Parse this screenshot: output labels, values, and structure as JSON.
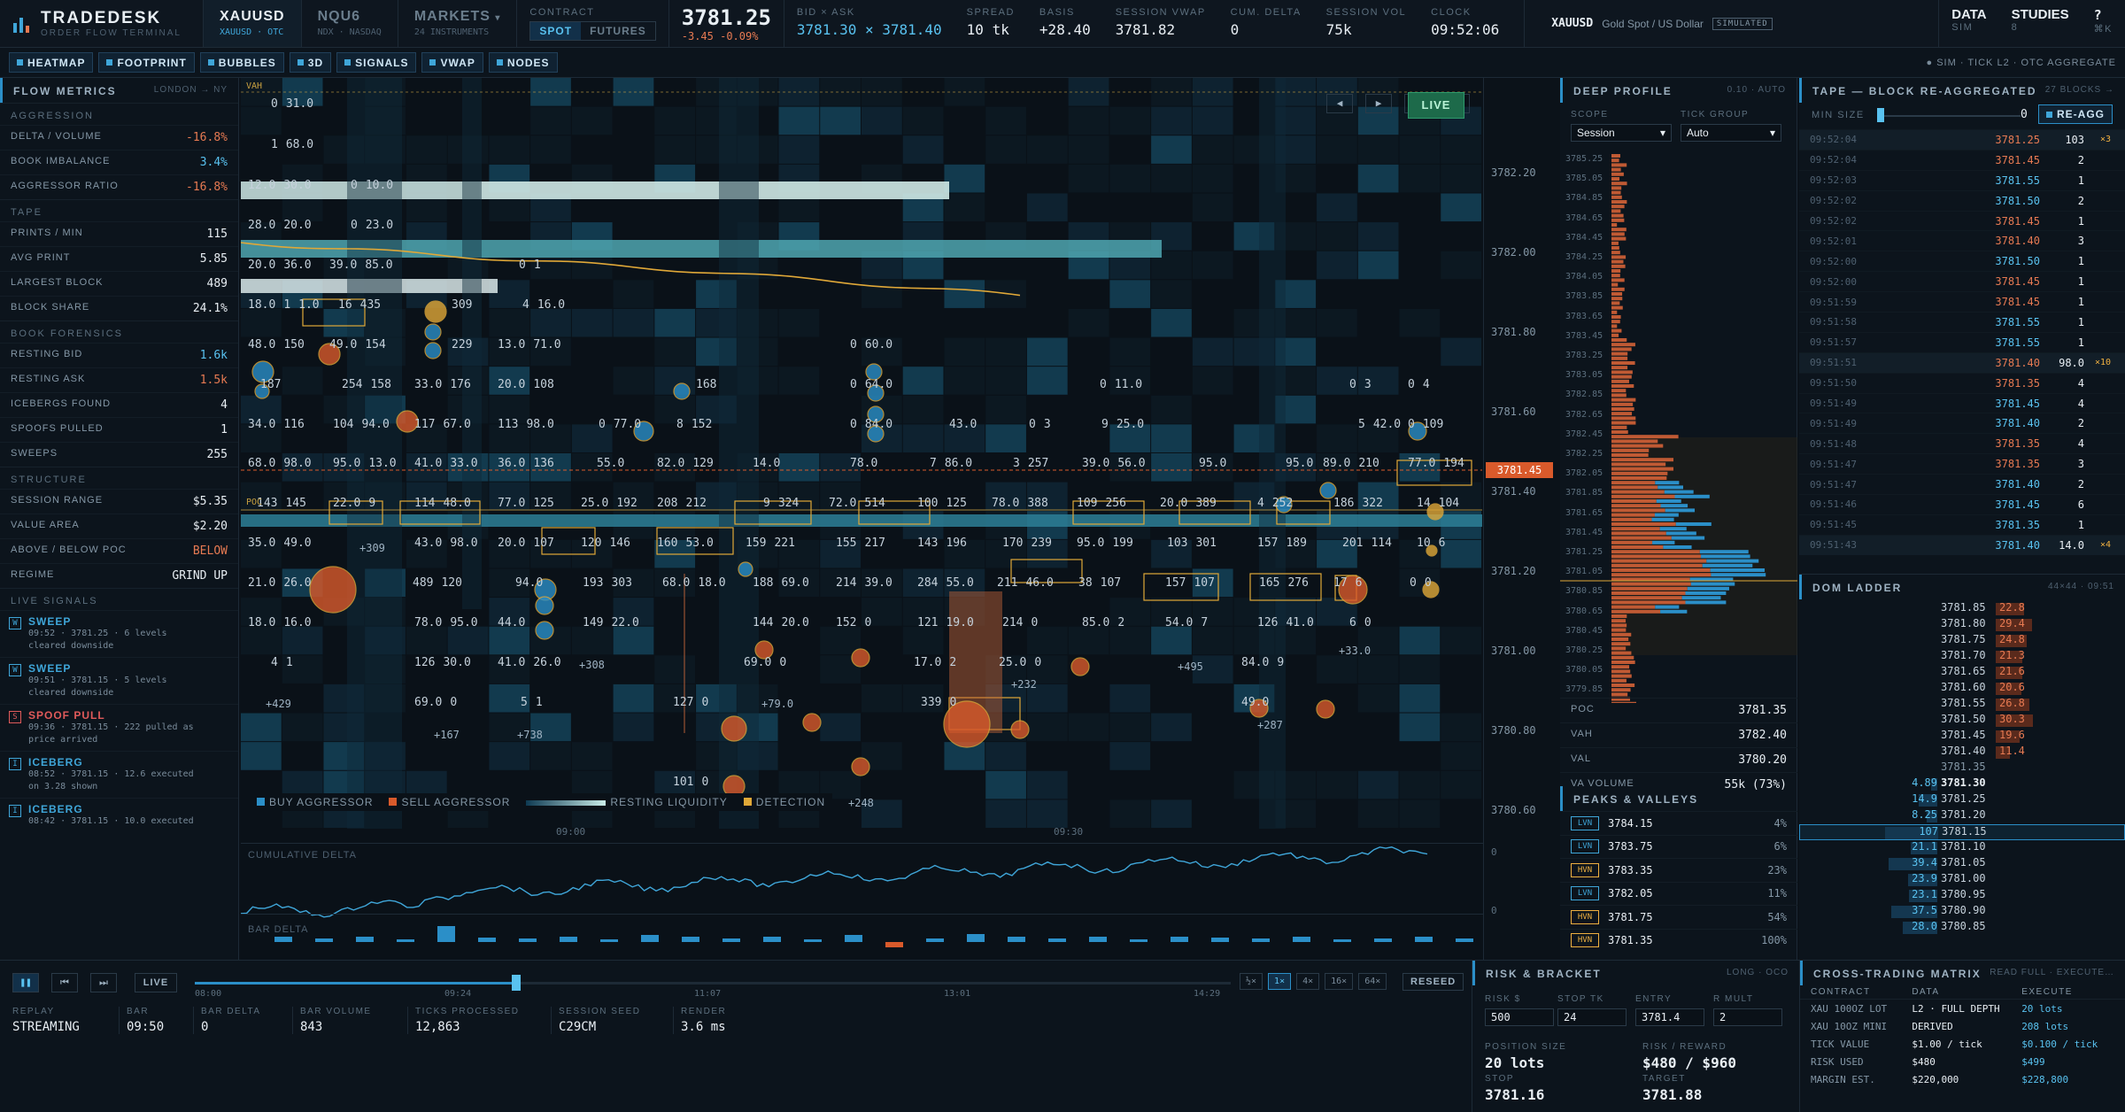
{
  "header": {
    "brand": "TRADEDESK",
    "brand_sub": "ORDER FLOW TERMINAL",
    "symbols": [
      {
        "name": "XAUUSD",
        "desc": "XAUUSD · OTC",
        "active": true
      },
      {
        "name": "NQU6",
        "desc": "NDX · NASDAQ",
        "active": false
      },
      {
        "name": "MARKETS",
        "desc": "24 INSTRUMENTS",
        "active": false
      }
    ],
    "contract_label": "CONTRACT",
    "spot": "SPOT",
    "futures": "FUTURES",
    "last": "3781.25",
    "change": "-3.45 -0.09%",
    "stats": [
      {
        "l": "BID × ASK",
        "v": "3781.30 × 3781.40"
      },
      {
        "l": "SPREAD",
        "v": "10 tk"
      },
      {
        "l": "BASIS",
        "v": "+28.40"
      },
      {
        "l": "SESSION VWAP",
        "v": "3781.82"
      },
      {
        "l": "CUM. DELTA",
        "v": "0"
      },
      {
        "l": "SESSION VOL",
        "v": "75k"
      },
      {
        "l": "CLOCK",
        "v": "09:52:06"
      }
    ],
    "instrument": "XAUUSD",
    "instrument_desc": "Gold Spot / US Dollar",
    "simulated": "SIMULATED",
    "data": "DATA",
    "data_sub": "SIM",
    "studies": "STUDIES",
    "studies_sub": "8",
    "help": "?",
    "help_sub": "⌘K"
  },
  "toolbar": {
    "buttons": [
      "HEATMAP",
      "FOOTPRINT",
      "BUBBLES",
      "3D",
      "SIGNALS",
      "VWAP",
      "NODES"
    ],
    "status": "● SIM · TICK L2 · OTC AGGREGATE"
  },
  "flow": {
    "title": "FLOW METRICS",
    "session": "LONDON → NY",
    "aggression_h": "AGGRESSION",
    "aggression": [
      {
        "k": "DELTA / VOLUME",
        "v": "-16.8%",
        "c": "neg"
      },
      {
        "k": "BOOK IMBALANCE",
        "v": "3.4%",
        "c": "pos"
      },
      {
        "k": "AGGRESSOR RATIO",
        "v": "-16.8%",
        "c": "neg"
      }
    ],
    "tape_h": "TAPE",
    "tape": [
      {
        "k": "PRINTS / MIN",
        "v": "115"
      },
      {
        "k": "AVG PRINT",
        "v": "5.85"
      },
      {
        "k": "LARGEST BLOCK",
        "v": "489"
      },
      {
        "k": "BLOCK SHARE",
        "v": "24.1%"
      }
    ],
    "forensics_h": "BOOK FORENSICS",
    "forensics": [
      {
        "k": "RESTING BID",
        "v": "1.6k",
        "c": "pos"
      },
      {
        "k": "RESTING ASK",
        "v": "1.5k",
        "c": "neg"
      },
      {
        "k": "ICEBERGS FOUND",
        "v": "4"
      },
      {
        "k": "SPOOFS PULLED",
        "v": "1"
      },
      {
        "k": "SWEEPS",
        "v": "255"
      }
    ],
    "structure_h": "STRUCTURE",
    "structure": [
      {
        "k": "SESSION RANGE",
        "v": "$5.35"
      },
      {
        "k": "VALUE AREA",
        "v": "$2.20"
      },
      {
        "k": "ABOVE / BELOW POC",
        "v": "BELOW",
        "c": "neg"
      },
      {
        "k": "REGIME",
        "v": "GRIND UP"
      }
    ],
    "signals_h": "LIVE SIGNALS",
    "signals": [
      {
        "b": "W",
        "t": "SWEEP",
        "d": "09:52 · 3781.25 · 6 levels cleared downside"
      },
      {
        "b": "W",
        "t": "SWEEP",
        "d": "09:51 · 3781.15 · 5 levels cleared downside"
      },
      {
        "b": "S",
        "t": "SPOOF PULL",
        "d": "09:36 · 3781.15 · 222 pulled as price arrived"
      },
      {
        "b": "I",
        "t": "ICEBERG",
        "d": "08:52 · 3781.15 · 12.6 executed on 3.28 shown"
      },
      {
        "b": "I",
        "t": "ICEBERG",
        "d": "08:42 · 3781.15 · 10.0 executed"
      }
    ]
  },
  "chart": {
    "vah": "VAH",
    "poc": "POC",
    "live": "LIVE",
    "prices": [
      "3782.20",
      "3782.00",
      "3781.80",
      "3781.60",
      "3781.40",
      "3781.20",
      "3781.00",
      "3780.80",
      "3780.60"
    ],
    "last_tag": "3781.45",
    "times": [
      "09:00",
      "09:30"
    ],
    "legend": [
      "BUY AGGRESSOR",
      "SELL AGGRESSOR",
      "RESTING LIQUIDITY",
      "DETECTION"
    ],
    "cum_delta": "CUMULATIVE DELTA",
    "bar_delta": "BAR DELTA",
    "cd_zero": "0",
    "bd_zero": "0",
    "cells": [
      [
        "0",
        "31.0"
      ],
      [
        "1",
        "68.0"
      ],
      [
        "12.0",
        "30.0"
      ],
      [
        "0",
        "10.0"
      ],
      [
        "28.0",
        "20.0"
      ],
      [
        "0",
        "23.0"
      ],
      [
        "20.0",
        "36.0"
      ],
      [
        "39.0",
        "85.0"
      ],
      [
        "0",
        "1"
      ],
      [
        "18.0",
        "1",
        "1.0"
      ],
      [
        "16",
        "435"
      ],
      [
        "309"
      ],
      [
        "4",
        "16.0"
      ],
      [
        "48.0",
        "150"
      ],
      [
        "49.0",
        "154"
      ],
      [
        "229"
      ],
      [
        "13.0",
        "71.0"
      ],
      [
        "0",
        "60.0"
      ],
      [
        "187"
      ],
      [
        "254",
        "158"
      ],
      [
        "33.0",
        "176"
      ],
      [
        "20.0",
        "108"
      ],
      [
        "168"
      ],
      [
        "0",
        "64.0"
      ],
      [
        "0",
        "11.0"
      ],
      [
        "0",
        "3"
      ],
      [
        "0",
        "4"
      ],
      [
        "34.0",
        "116"
      ],
      [
        "104",
        "94.0"
      ],
      [
        "117",
        "67.0"
      ],
      [
        "113",
        "98.0"
      ],
      [
        "0",
        "77.0"
      ],
      [
        "8",
        "152"
      ],
      [
        "0",
        "84.0"
      ],
      [
        "43.0"
      ],
      [
        "0",
        "3"
      ],
      [
        "9",
        "25.0"
      ],
      [
        "5",
        "42.0"
      ],
      [
        "0",
        "109"
      ],
      [
        "68.0",
        "98.0"
      ],
      [
        "95.0",
        "13.0"
      ],
      [
        "41.0",
        "33.0"
      ],
      [
        "36.0",
        "136"
      ],
      [
        "55.0"
      ],
      [
        "82.0",
        "129"
      ],
      [
        "14.0"
      ],
      [
        "78.0"
      ],
      [
        "7",
        "86.0"
      ],
      [
        "3",
        "257"
      ],
      [
        "39.0",
        "56.0"
      ],
      [
        "95.0"
      ],
      [
        "95.0"
      ],
      [
        "89.0",
        "210"
      ],
      [
        "77.0",
        "194"
      ],
      [
        "143",
        "145"
      ],
      [
        "22.0",
        "9"
      ],
      [
        "114",
        "48.0"
      ],
      [
        "77.0",
        "125"
      ],
      [
        "25.0",
        "192"
      ],
      [
        "208",
        "212"
      ],
      [
        "9",
        "324"
      ],
      [
        "72.0",
        "514"
      ],
      [
        "100",
        "125"
      ],
      [
        "78.0",
        "388"
      ],
      [
        "109",
        "256"
      ],
      [
        "20.0",
        "389"
      ],
      [
        "4",
        "252"
      ],
      [
        "186",
        "322"
      ],
      [
        "14",
        "104"
      ],
      [
        "35.0",
        "49.0"
      ],
      [
        "43.0",
        "98.0"
      ],
      [
        "20.0",
        "107"
      ],
      [
        "120",
        "146"
      ],
      [
        "160",
        "53.0"
      ],
      [
        "159",
        "221"
      ],
      [
        "155",
        "217"
      ],
      [
        "143",
        "196"
      ],
      [
        "170",
        "239"
      ],
      [
        "95.0",
        "199"
      ],
      [
        "103",
        "301"
      ],
      [
        "157",
        "189"
      ],
      [
        "201",
        "114"
      ],
      [
        "10",
        "6"
      ],
      [
        "21.0",
        "26.0"
      ],
      [
        "489",
        "120"
      ],
      [
        "94.0"
      ],
      [
        "193",
        "303"
      ],
      [
        "68.0",
        "18.0"
      ],
      [
        "188",
        "69.0"
      ],
      [
        "214",
        "39.0"
      ],
      [
        "284",
        "55.0"
      ],
      [
        "211",
        "46.0"
      ],
      [
        "38",
        "107"
      ],
      [
        "157",
        "107"
      ],
      [
        "165",
        "276"
      ],
      [
        "17",
        "6"
      ],
      [
        "0",
        "0"
      ],
      [
        "18.0",
        "16.0"
      ],
      [
        "78.0",
        "95.0"
      ],
      [
        "44.0"
      ],
      [
        "149",
        "22.0"
      ],
      [
        "144",
        "20.0"
      ],
      [
        "152",
        "0"
      ],
      [
        "121",
        "19.0"
      ],
      [
        "214",
        "0"
      ],
      [
        "85.0",
        "2"
      ],
      [
        "54.0",
        "7"
      ],
      [
        "126",
        "41.0"
      ],
      [
        "6",
        "0"
      ],
      [
        "4",
        "1"
      ],
      [
        "126",
        "30.0"
      ],
      [
        "41.0",
        "26.0"
      ],
      [
        "69.0",
        "0"
      ],
      [
        "17.0",
        "2"
      ],
      [
        "25.0",
        "0"
      ],
      [
        "84.0",
        "9"
      ],
      [
        "69.0",
        "0"
      ],
      [
        "5",
        "1"
      ],
      [
        "127",
        "0"
      ],
      [
        "339",
        "0"
      ],
      [
        "49.0"
      ],
      [
        "101",
        "0"
      ]
    ],
    "annotations": [
      "+309",
      "+308",
      "+79.0",
      "+232",
      "+495",
      "+33.0",
      "+429",
      "+167",
      "+738",
      "+287",
      "+248"
    ]
  },
  "replay": {
    "live": "LIVE",
    "times": [
      "08:00",
      "09:24",
      "11:07",
      "13:01",
      "14:29"
    ],
    "speeds": [
      "½×",
      "1×",
      "4×",
      "16×",
      "64×"
    ],
    "reseed": "RESEED",
    "stats": [
      {
        "l": "REPLAY",
        "v": "STREAMING"
      },
      {
        "l": "BAR",
        "v": "09:50"
      },
      {
        "l": "BAR DELTA",
        "v": "0"
      },
      {
        "l": "BAR VOLUME",
        "v": "843"
      },
      {
        "l": "TICKS PROCESSED",
        "v": "12,863"
      },
      {
        "l": "SESSION SEED",
        "v": "C29CM"
      },
      {
        "l": "RENDER",
        "v": "3.6 ms"
      }
    ],
    "progress": 0.31
  },
  "deep": {
    "title": "DEEP PROFILE",
    "sub": "0.10 · auto",
    "scope_l": "SCOPE",
    "scope": "Session",
    "tick_l": "TICK GROUP",
    "tick": "Auto",
    "levels": [
      "3785.25",
      "3785.05",
      "3784.85",
      "3784.65",
      "3784.45",
      "3784.25",
      "3784.05",
      "3783.85",
      "3783.65",
      "3783.45",
      "3783.25",
      "3783.05",
      "3782.85",
      "3782.65",
      "3782.45",
      "3782.25",
      "3782.05",
      "3781.85",
      "3781.65",
      "3781.45",
      "3781.25",
      "3781.05",
      "3780.85",
      "3780.65",
      "3780.45",
      "3780.25",
      "3780.05",
      "3779.85"
    ],
    "stats": [
      {
        "k": "POC",
        "v": "3781.35"
      },
      {
        "k": "VAH",
        "v": "3782.40"
      },
      {
        "k": "VAL",
        "v": "3780.20"
      },
      {
        "k": "VA VOLUME",
        "v": "55k (73%)"
      }
    ],
    "peaks_h": "PEAKS & VALLEYS",
    "peaks": [
      {
        "t": "LVN",
        "p": "3784.15",
        "v": "4%"
      },
      {
        "t": "LVN",
        "p": "3783.75",
        "v": "6%"
      },
      {
        "t": "HVN",
        "p": "3783.35",
        "v": "23%"
      },
      {
        "t": "LVN",
        "p": "3782.05",
        "v": "11%"
      },
      {
        "t": "HVN",
        "p": "3781.75",
        "v": "54%"
      },
      {
        "t": "HVN",
        "p": "3781.35",
        "v": "100%"
      }
    ]
  },
  "tape": {
    "title": "TAPE — BLOCK RE-AGGREGATED",
    "sub": "27 blocks →",
    "min_l": "MIN SIZE",
    "min_v": "0",
    "reagg": "RE-AGG",
    "rows": [
      [
        "09:52:04",
        "3781.25",
        "103",
        "×3",
        "n"
      ],
      [
        "09:52:04",
        "3781.45",
        "2",
        "",
        "n"
      ],
      [
        "09:52:03",
        "3781.55",
        "1",
        "",
        "p"
      ],
      [
        "09:52:02",
        "3781.50",
        "2",
        "",
        "p"
      ],
      [
        "09:52:02",
        "3781.45",
        "1",
        "",
        "n"
      ],
      [
        "09:52:01",
        "3781.40",
        "3",
        "",
        "n"
      ],
      [
        "09:52:00",
        "3781.50",
        "1",
        "",
        "p"
      ],
      [
        "09:52:00",
        "3781.45",
        "1",
        "",
        "n"
      ],
      [
        "09:51:59",
        "3781.45",
        "1",
        "",
        "n"
      ],
      [
        "09:51:58",
        "3781.55",
        "1",
        "",
        "p"
      ],
      [
        "09:51:57",
        "3781.55",
        "1",
        "",
        "p"
      ],
      [
        "09:51:51",
        "3781.40",
        "98.0",
        "×10",
        "n"
      ],
      [
        "09:51:50",
        "3781.35",
        "4",
        "",
        "n"
      ],
      [
        "09:51:49",
        "3781.45",
        "4",
        "",
        "p"
      ],
      [
        "09:51:49",
        "3781.40",
        "2",
        "",
        "p"
      ],
      [
        "09:51:48",
        "3781.35",
        "4",
        "",
        "n"
      ],
      [
        "09:51:47",
        "3781.35",
        "3",
        "",
        "n"
      ],
      [
        "09:51:47",
        "3781.40",
        "2",
        "",
        "p"
      ],
      [
        "09:51:46",
        "3781.45",
        "6",
        "",
        "p"
      ],
      [
        "09:51:45",
        "3781.35",
        "1",
        "",
        "p"
      ],
      [
        "09:51:43",
        "3781.40",
        "14.0",
        "×4",
        "p"
      ]
    ]
  },
  "dom": {
    "title": "DOM LADDER",
    "sub": "44×44 · 09:51",
    "asks": [
      [
        "3781.85",
        "22.8"
      ],
      [
        "3781.80",
        "29.4"
      ],
      [
        "3781.75",
        "24.8"
      ],
      [
        "3781.70",
        "21.3"
      ],
      [
        "3781.65",
        "21.6"
      ],
      [
        "3781.60",
        "20.6"
      ],
      [
        "3781.55",
        "26.8"
      ],
      [
        "3781.50",
        "30.3"
      ],
      [
        "3781.45",
        "19.6"
      ],
      [
        "3781.40",
        "11.4"
      ]
    ],
    "mid": "3781.35",
    "bids": [
      [
        "4.89",
        "3781.30"
      ],
      [
        "14.9",
        "3781.25"
      ],
      [
        "8.25",
        "3781.20"
      ],
      [
        "107",
        "3781.15"
      ],
      [
        "21.1",
        "3781.10"
      ],
      [
        "39.4",
        "3781.05"
      ],
      [
        "23.9",
        "3781.00"
      ],
      [
        "23.1",
        "3780.95"
      ],
      [
        "37.5",
        "3780.90"
      ],
      [
        "28.0",
        "3780.85"
      ]
    ]
  },
  "risk": {
    "title": "RISK & BRACKET",
    "sub": "LONG · OCO",
    "inputs": [
      {
        "l": "RISK $",
        "v": "500"
      },
      {
        "l": "STOP TK",
        "v": "24"
      },
      {
        "l": "ENTRY",
        "v": "3781.4"
      },
      {
        "l": "R MULT",
        "v": "2"
      }
    ],
    "pos_l": "POSITION SIZE",
    "pos": "20 lots",
    "rr_l": "RISK / REWARD",
    "rr": "$480 / $960",
    "stop_l": "STOP",
    "stop": "3781.16",
    "target_l": "TARGET",
    "target": "3781.88"
  },
  "xtm": {
    "title": "CROSS-TRADING MATRIX",
    "sub": "Read full · execute…",
    "cols": [
      "CONTRACT",
      "DATA",
      "EXECUTE"
    ],
    "rows": [
      [
        "XAU 100OZ LOT",
        "L2 · FULL DEPTH",
        "20 lots"
      ],
      [
        "XAU 10OZ MINI",
        "DERIVED",
        "208 lots"
      ],
      [
        "TICK VALUE",
        "$1.00 / tick",
        "$0.100 / tick"
      ],
      [
        "RISK USED",
        "$480",
        "$499"
      ],
      [
        "MARGIN EST.",
        "$220,000",
        "$228,800"
      ]
    ]
  }
}
